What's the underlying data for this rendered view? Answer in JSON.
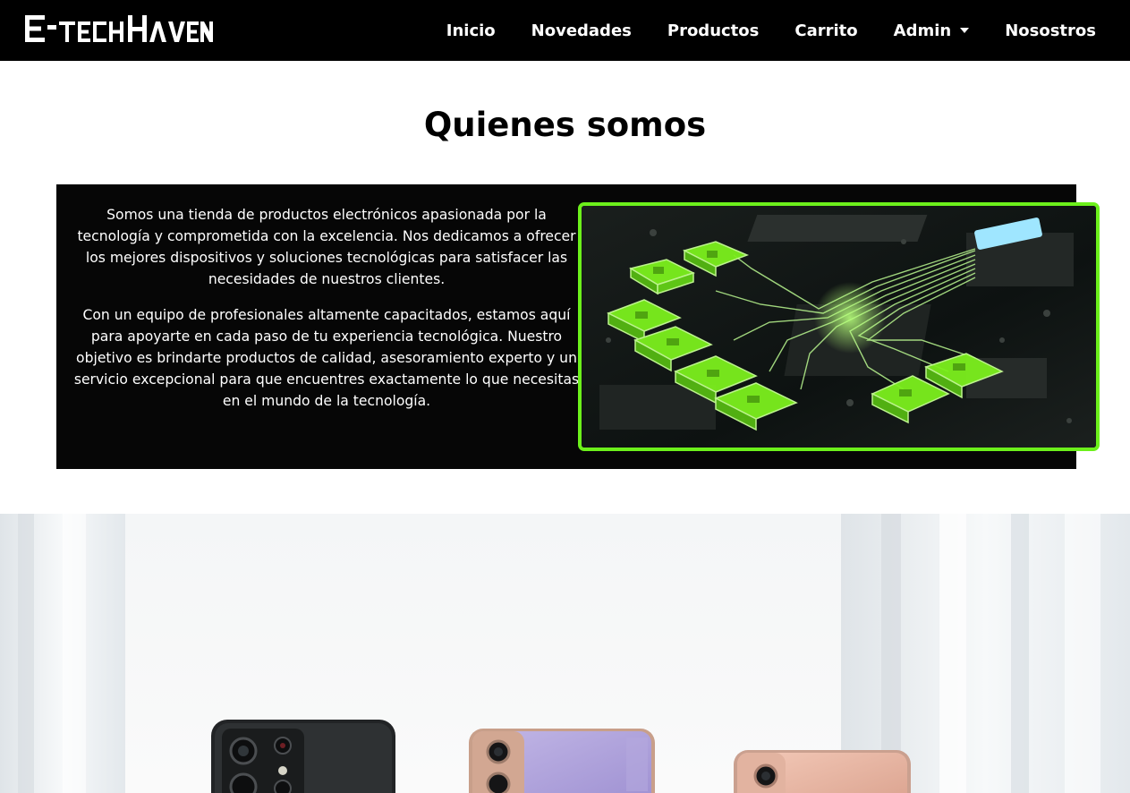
{
  "nav": {
    "logo_text": "E-TECH HAVEN",
    "links": [
      {
        "label": "Inicio"
      },
      {
        "label": "Novedades"
      },
      {
        "label": "Productos"
      },
      {
        "label": "Carrito"
      },
      {
        "label": "Admin"
      },
      {
        "label": "Nosostros"
      }
    ]
  },
  "about": {
    "title": "Quienes somos",
    "paragraphs": [
      "Somos una tienda de productos electrónicos apasionada por la tecnología y comprometida con la excelencia. Nos dedicamos a ofrecer los mejores dispositivos y soluciones tecnológicas para satisfacer las necesidades de nuestros clientes.",
      "Con un equipo de profesionales altamente capacitados, estamos aquí para apoyarte en cada paso de tu experiencia tecnológica. Nuestro objetivo es brindarte productos de calidad, asesoramiento experto y un servicio excepcional para que encuentres exactamente lo que necesitas en el mundo de la tecnología."
    ]
  },
  "colors": {
    "nav_bg": "#000000",
    "about_bg": "#060606",
    "accent_green": "#6cf01b"
  },
  "icons": [
    "logo",
    "caret-down-icon"
  ]
}
